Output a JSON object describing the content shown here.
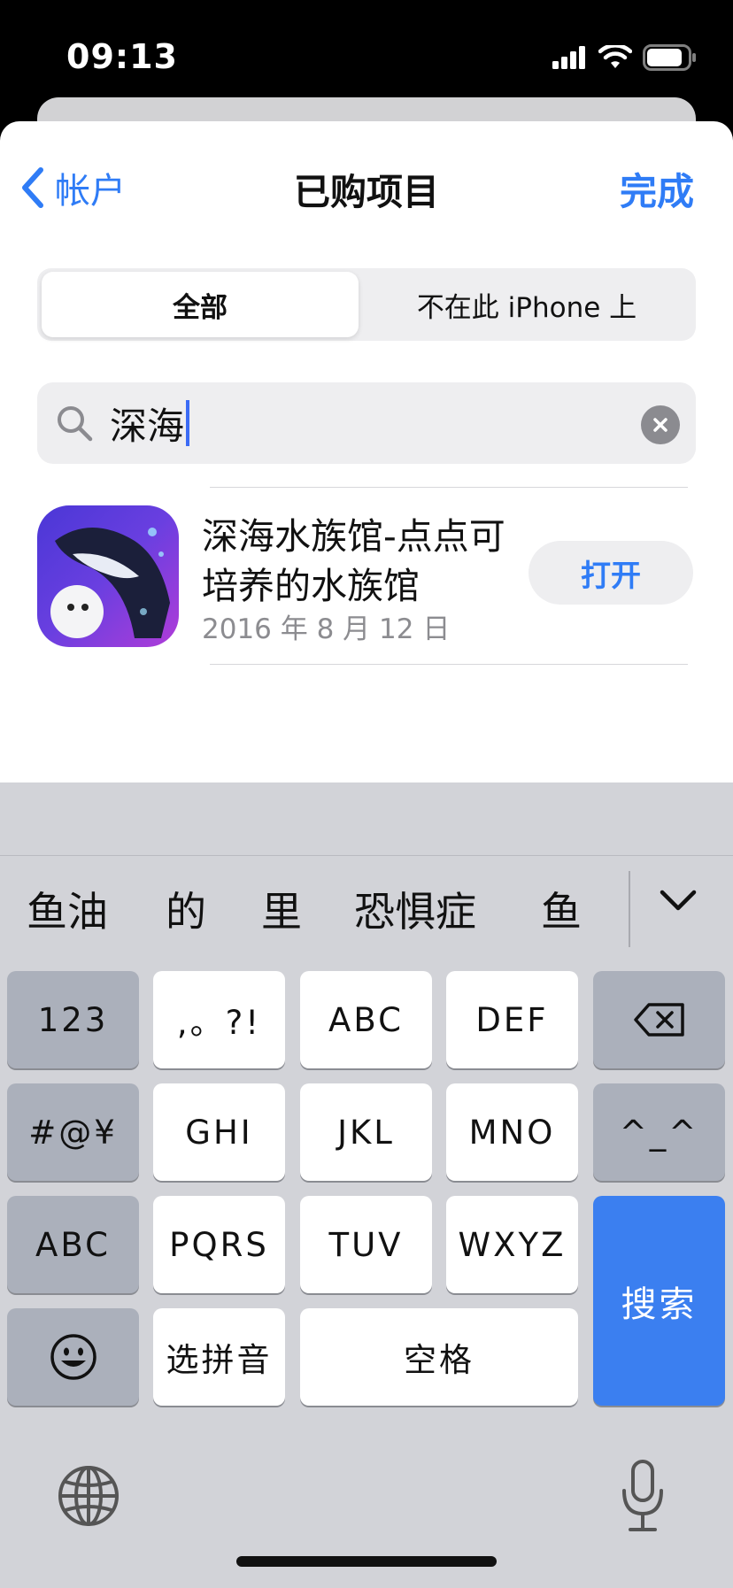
{
  "status_bar": {
    "time": "09:13"
  },
  "nav": {
    "back_label": "帐户",
    "title": "已购项目",
    "done_label": "完成"
  },
  "segment": {
    "all": "全部",
    "not_on_device": "不在此 iPhone 上"
  },
  "search": {
    "query": "深海"
  },
  "results": [
    {
      "name": "深海水族馆-点点可培养的水族馆",
      "date": "2016 年 8 月 12 日",
      "action": "打开"
    }
  ],
  "keyboard": {
    "candidates": [
      "鱼油",
      "的",
      "里",
      "恐惧症",
      "鱼"
    ],
    "row1": [
      "123",
      ",。?!",
      "ABC",
      "DEF"
    ],
    "row2": [
      "#@¥",
      "GHI",
      "JKL",
      "MNO",
      "^_^"
    ],
    "row3": [
      "ABC",
      "PQRS",
      "TUV",
      "WXYZ"
    ],
    "row4": [
      "选拼音",
      "空格"
    ],
    "search_label": "搜索"
  },
  "colors": {
    "accent": "#2f7cf6",
    "search_key": "#3b7ff0"
  }
}
